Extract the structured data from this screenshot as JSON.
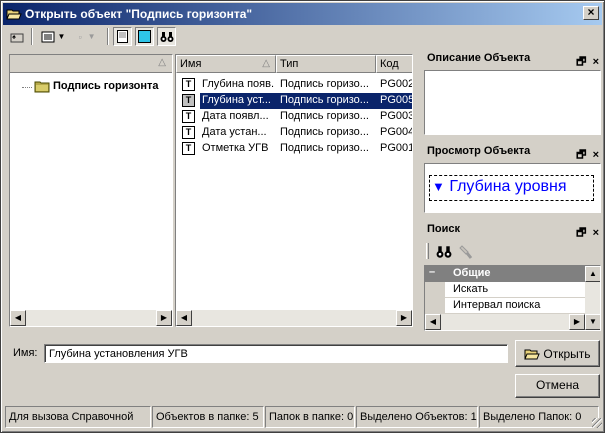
{
  "window": {
    "title": "Открыть объект \"Подпись горизонта\""
  },
  "tree": {
    "root_label": "Подпись горизонта"
  },
  "file_list": {
    "columns": [
      "Имя",
      "Тип",
      "Код"
    ],
    "rows": [
      {
        "name": "Глубина появ...",
        "type": "Подпись горизо...",
        "code": "PG002",
        "selected": false
      },
      {
        "name": "Глубина уст...",
        "type": "Подпись горизо...",
        "code": "PG005",
        "selected": true
      },
      {
        "name": "Дата появл...",
        "type": "Подпись горизо...",
        "code": "PG003",
        "selected": false
      },
      {
        "name": "Дата устан...",
        "type": "Подпись горизо...",
        "code": "PG004",
        "selected": false
      },
      {
        "name": "Отметка УГВ",
        "type": "Подпись горизо...",
        "code": "PG001",
        "selected": false
      }
    ]
  },
  "description_panel": {
    "title": "Описание Объекта"
  },
  "preview_panel": {
    "title": "Просмотр Объекта",
    "preview_text": "Глубина уровня"
  },
  "search_panel": {
    "title": "Поиск",
    "group_label": "Общие",
    "items": [
      "Искать",
      "Интервал поиска"
    ]
  },
  "name_field": {
    "label": "Имя:",
    "value": "Глубина установления УГВ"
  },
  "buttons": {
    "open": "Открыть",
    "cancel": "Отмена"
  },
  "statusbar": {
    "hint": "Для вызова Справочной",
    "objects_in_folder": "Объектов в папке: 5",
    "folders_in_folder": "Папок в папке: 0",
    "selected_objects": "Выделено Объектов: 1",
    "selected_folders": "Выделено Папок: 0"
  },
  "colors": {
    "title_start": "#0a246a",
    "title_end": "#a6caf0",
    "selection": "#0a246a",
    "preview_text": "#0000ff",
    "face": "#d4d0c8"
  },
  "icons": {
    "title": "open-folder-icon",
    "up": "up-folder-icon",
    "view": "list-view-icon",
    "find": "binoculars-icon",
    "object": "text-object-icon"
  }
}
